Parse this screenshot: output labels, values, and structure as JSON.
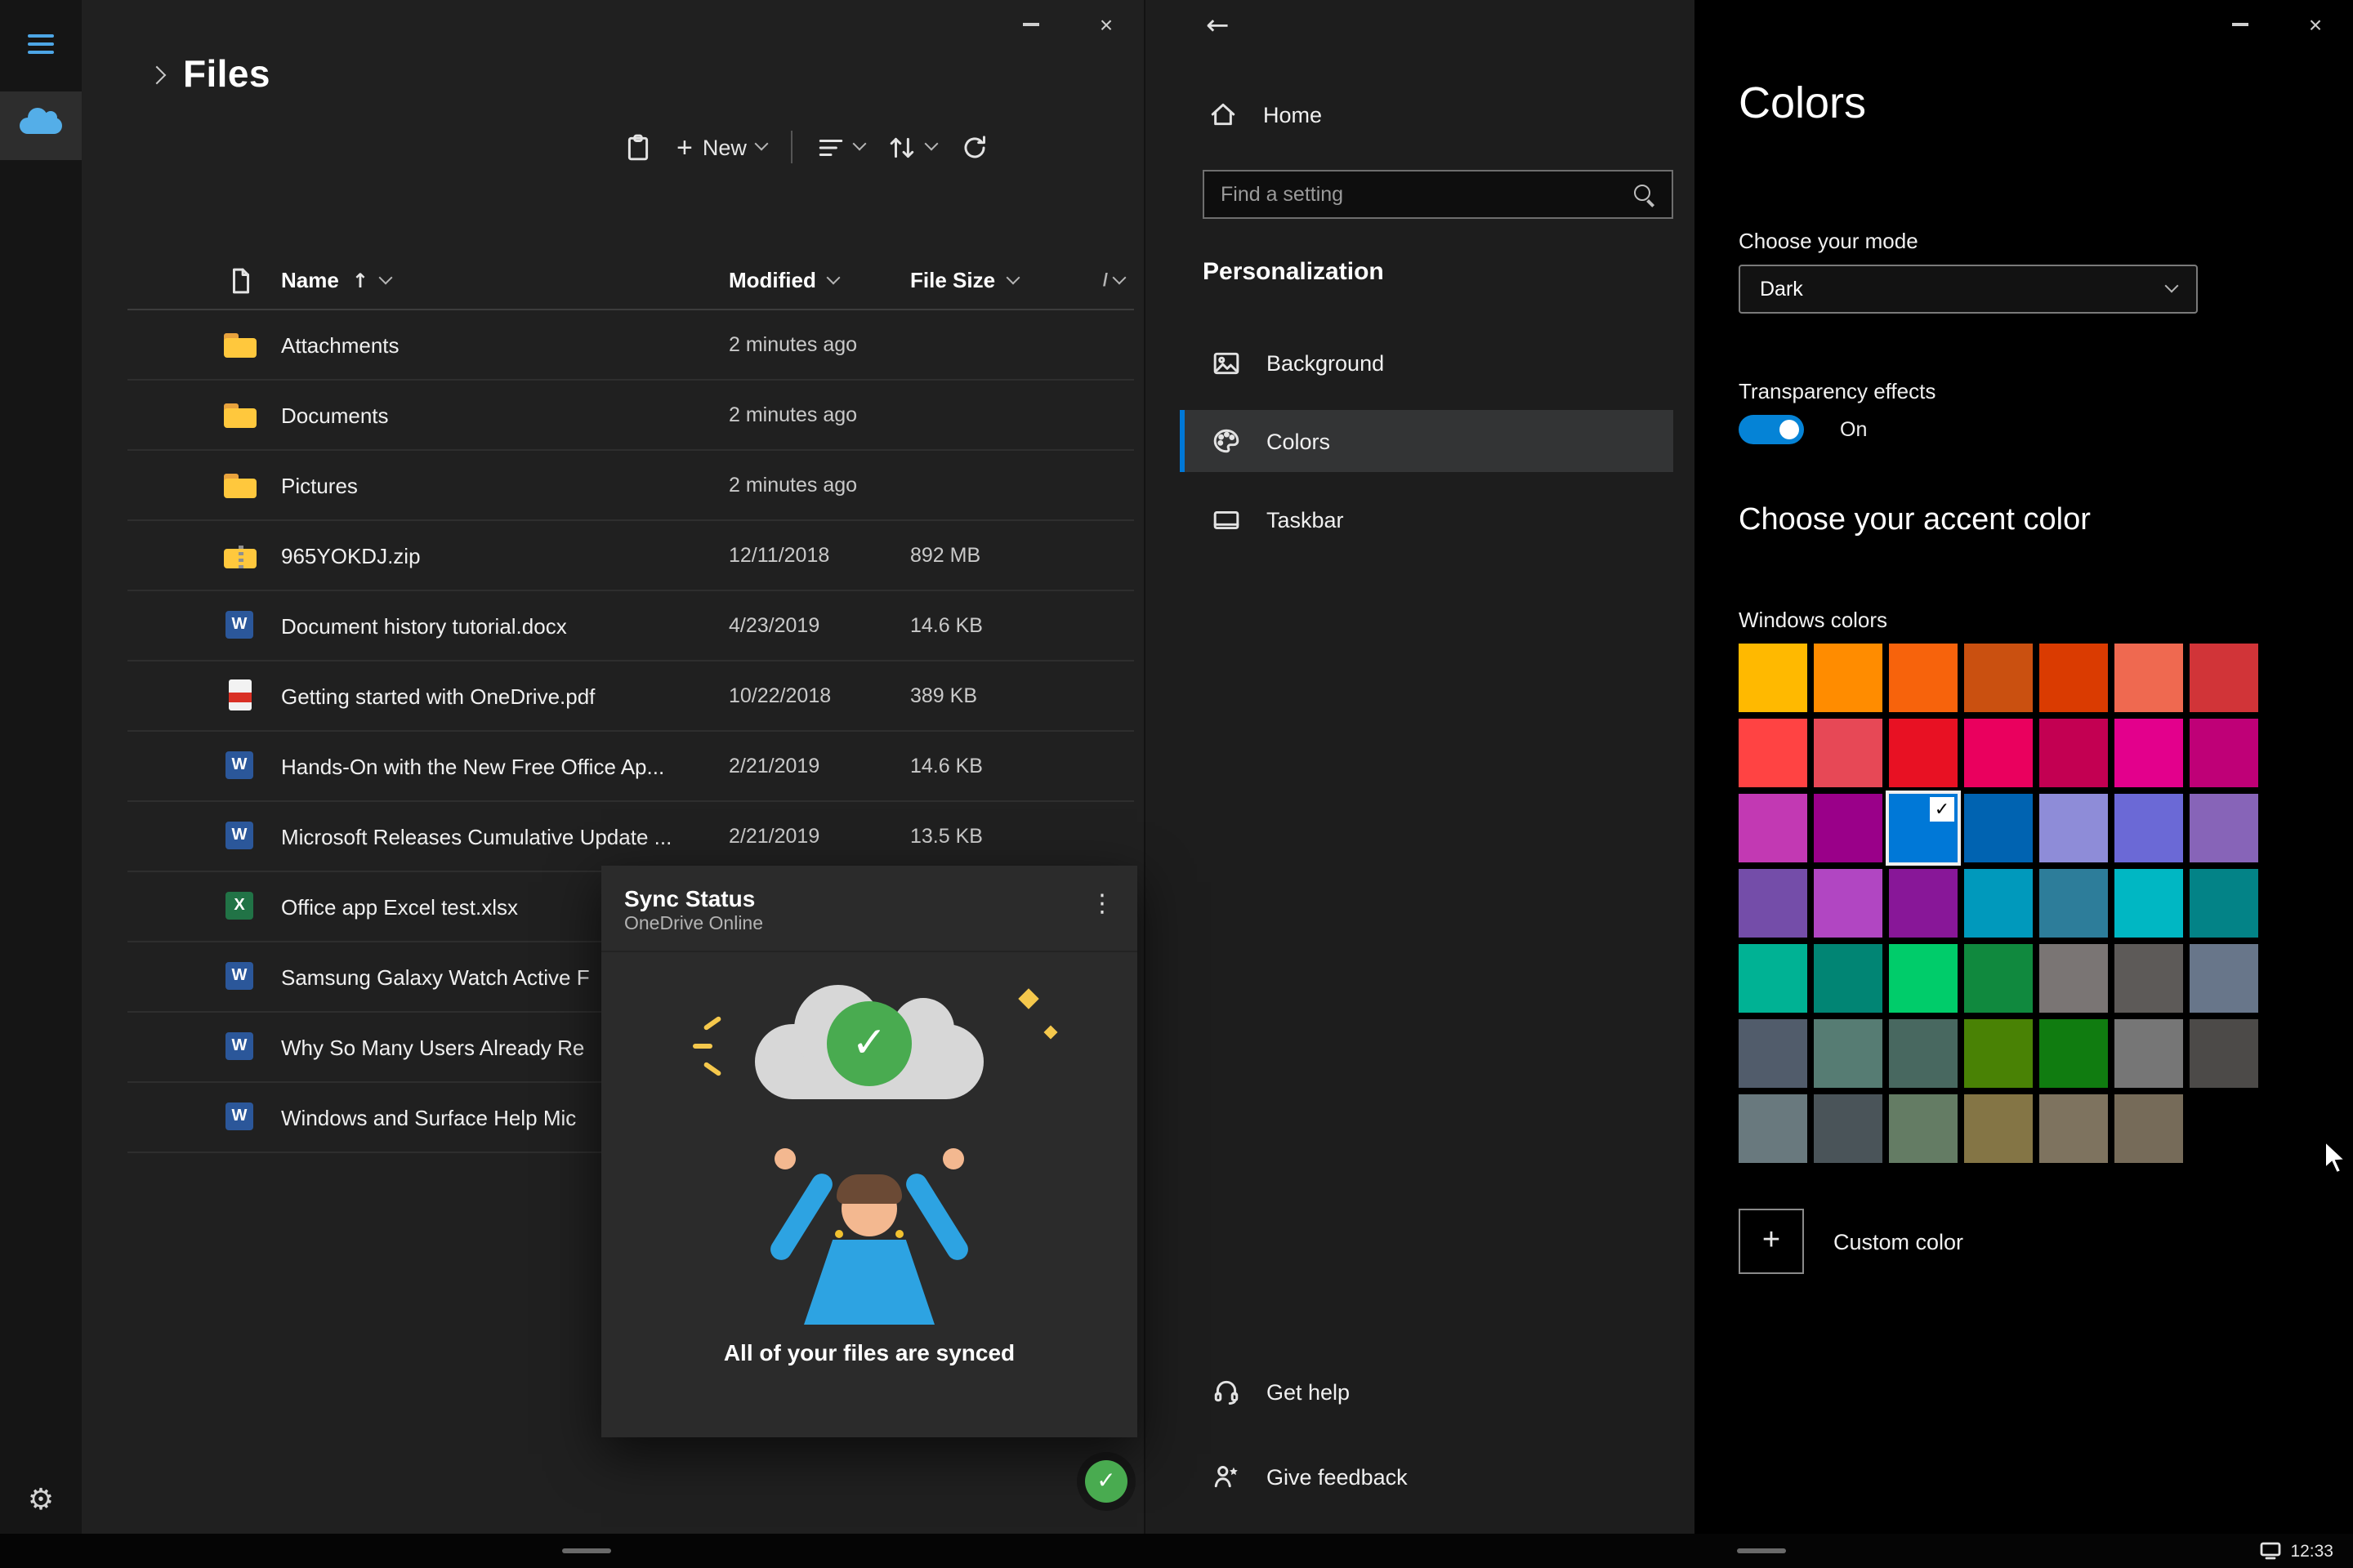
{
  "onedrive": {
    "title": "Files",
    "toolbar": {
      "new_label": "New"
    },
    "table": {
      "columns": {
        "name": "Name",
        "modified": "Modified",
        "size": "File Size"
      },
      "rows": [
        {
          "name": "Attachments",
          "type": "folder",
          "modified": "2 minutes ago",
          "size": ""
        },
        {
          "name": "Documents",
          "type": "folder",
          "modified": "2 minutes ago",
          "size": ""
        },
        {
          "name": "Pictures",
          "type": "folder",
          "modified": "2 minutes ago",
          "size": ""
        },
        {
          "name": "965YOKDJ.zip",
          "type": "zip",
          "modified": "12/11/2018",
          "size": "892 MB"
        },
        {
          "name": "Document history tutorial.docx",
          "type": "word",
          "modified": "4/23/2019",
          "size": "14.6 KB"
        },
        {
          "name": "Getting started with OneDrive.pdf",
          "type": "pdf",
          "modified": "10/22/2018",
          "size": "389 KB"
        },
        {
          "name": "Hands-On with the New Free Office Ap...",
          "type": "word",
          "modified": "2/21/2019",
          "size": "14.6 KB"
        },
        {
          "name": "Microsoft Releases Cumulative Update ...",
          "type": "word",
          "modified": "2/21/2019",
          "size": "13.5 KB"
        },
        {
          "name": "Office app Excel test.xlsx",
          "type": "excel",
          "modified": "",
          "size": ""
        },
        {
          "name": "Samsung Galaxy Watch Active F",
          "type": "word",
          "modified": "",
          "size": ""
        },
        {
          "name": "Why So Many Users Already Re",
          "type": "word",
          "modified": "",
          "size": ""
        },
        {
          "name": "Windows and Surface Help Mic",
          "type": "word",
          "modified": "",
          "size": ""
        }
      ]
    },
    "sync_popup": {
      "title": "Sync Status",
      "subtitle": "OneDrive Online",
      "message": "All of your files are synced"
    }
  },
  "settings": {
    "nav": {
      "home": "Home",
      "search_placeholder": "Find a setting",
      "section": "Personalization",
      "items": [
        {
          "label": "Background",
          "selected": false
        },
        {
          "label": "Colors",
          "selected": true
        },
        {
          "label": "Taskbar",
          "selected": false
        }
      ],
      "get_help": "Get help",
      "give_feedback": "Give feedback"
    },
    "colors_page": {
      "title": "Colors",
      "mode_label": "Choose your mode",
      "mode_value": "Dark",
      "transparency_label": "Transparency effects",
      "transparency_state": "On",
      "accent_heading": "Choose your accent color",
      "windows_colors_label": "Windows colors",
      "custom_color_label": "Custom color",
      "accent_color": "#0078d7",
      "selected_index": 16,
      "swatches": [
        "#ffb900",
        "#ff8c00",
        "#f7630c",
        "#ca5010",
        "#da3b01",
        "#ef6950",
        "#d13438",
        "#ff4343",
        "#e74856",
        "#e81123",
        "#ea005e",
        "#c30052",
        "#e3008c",
        "#bf0077",
        "#c239b3",
        "#9a0089",
        "#0078d7",
        "#0063b1",
        "#8e8cd8",
        "#6b69d6",
        "#8764b8",
        "#744da9",
        "#b146c2",
        "#881798",
        "#0099bc",
        "#2d7d9a",
        "#00b7c3",
        "#038387",
        "#00b294",
        "#018574",
        "#00cc6a",
        "#10893e",
        "#7a7574",
        "#5d5a58",
        "#68768a",
        "#515c6b",
        "#567c73",
        "#486860",
        "#498205",
        "#107c10",
        "#767676",
        "#4c4a48",
        "#69797e",
        "#4a5459",
        "#647c64",
        "#847545",
        "#7e735f",
        "#766b59"
      ]
    }
  },
  "taskbar": {
    "time": "12:33"
  }
}
